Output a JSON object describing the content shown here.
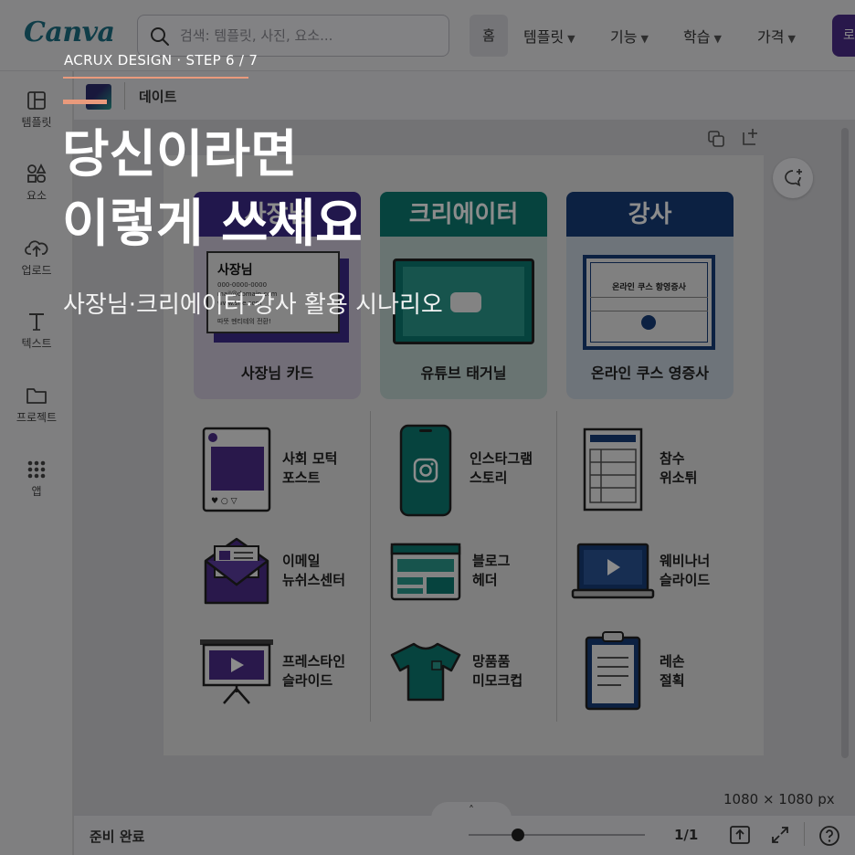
{
  "topbar": {
    "logo": "Canva",
    "search_placeholder": "검색: 템플릿, 사진, 요소...",
    "nav_home": "홈",
    "nav": [
      "템플릿",
      "기능",
      "학습",
      "가격"
    ],
    "cta": "로"
  },
  "sidebar": {
    "items": [
      "템플릿",
      "요소",
      "업로드",
      "텍스트",
      "프로젝트",
      "앱"
    ]
  },
  "doc": {
    "title": "데이트"
  },
  "canvas": {
    "columns": [
      {
        "header": "사장님",
        "header_color": "#3d2a8a",
        "feature_label": "사장님 카드",
        "feature_card": {
          "name": "사장님",
          "lines": [
            "000-0000-0000",
            "mail@domain.com",
            "www.site.com"
          ],
          "note": "따뜻 멘티테의 전환!"
        },
        "tiles": [
          "사회 모턱\n포스트",
          "이메일\n뉴쉬스센터",
          "프레스타인\n슬라이드"
        ]
      },
      {
        "header": "크리에이터",
        "header_color": "#0c7a72",
        "feature_label": "유튜브 태거닐",
        "tiles": [
          "인스타그램\n스토리",
          "블로그\n헤더",
          "망품품\n미모크컵"
        ]
      },
      {
        "header": "강사",
        "header_color": "#173d78",
        "feature_label": "온라인 쿠스 영증사",
        "feature_cert": "온라인 쿠스 항영증사",
        "tiles": [
          "참수\n위소튀",
          "웨비나너\n슬라이드",
          "레손\n절획"
        ]
      }
    ]
  },
  "status": {
    "label": "준비 완료",
    "size": "1080 × 1080 px",
    "pages": "1/1",
    "zoom_fraction": 0.28
  },
  "overlay": {
    "eyebrow": "ACRUX DESIGN · STEP 6 / 7",
    "title": "당신이라면\n이렇게 쓰세요",
    "subtitle": "사장님·크리에이터·강사 활용 시나리오"
  },
  "colors": {
    "accent": "#e99a7c",
    "purple": "#4c2d89",
    "teal": "#0c7a72",
    "navy": "#173d78"
  },
  "icons": {
    "search": "search-icon",
    "template": "template-icon",
    "elements": "elements-icon",
    "upload": "upload-icon",
    "text": "text-icon",
    "folder": "folder-icon",
    "apps": "apps-icon",
    "duplicate": "duplicate-icon",
    "add-page": "add-page-icon",
    "comment": "comment-icon",
    "present": "present-icon",
    "fullscreen": "fullscreen-icon",
    "help": "help-icon"
  }
}
